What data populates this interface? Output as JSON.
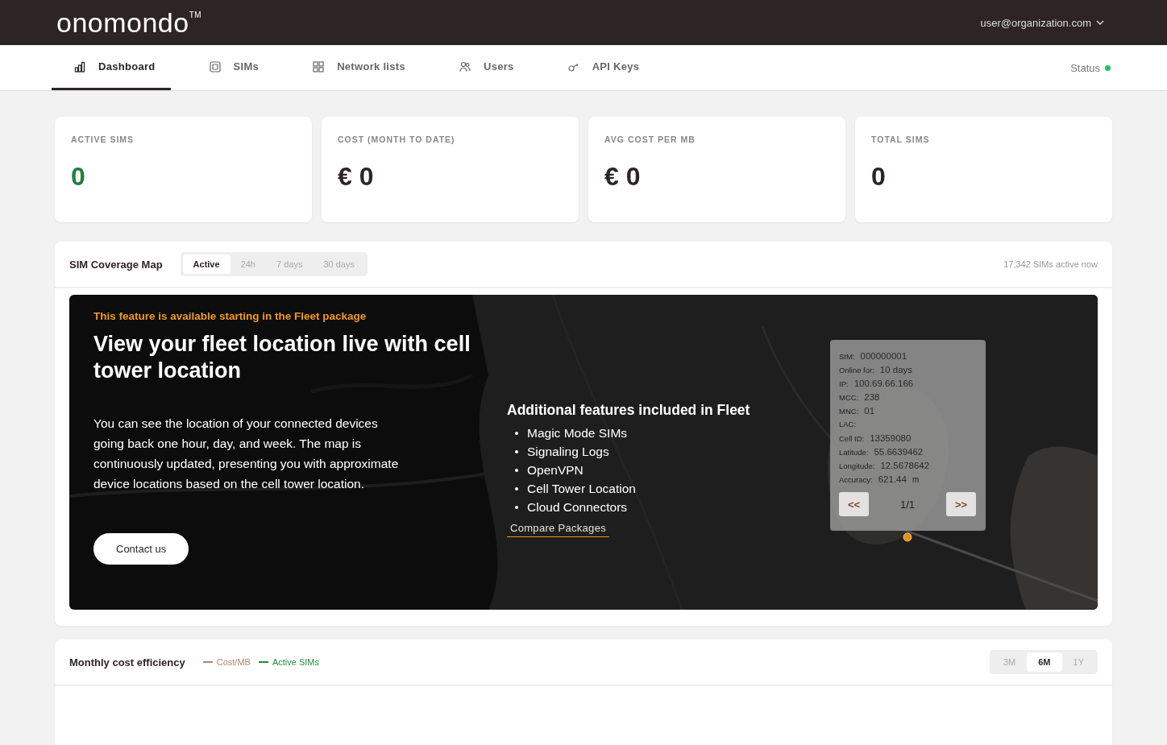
{
  "header": {
    "logo": "onomondo$^{TM}$",
    "account": "user@organization.com"
  },
  "nav": {
    "tabs": [
      {
        "label": "Dashboard",
        "selected": true
      },
      {
        "label": "SIMs",
        "selected": false
      },
      {
        "label": "Network lists",
        "selected": false
      },
      {
        "label": "Users",
        "selected": false
      },
      {
        "label": "API Keys",
        "selected": false
      }
    ],
    "status": {
      "label": "Status",
      "color": "#22c55e"
    }
  },
  "stats": [
    {
      "label": "ACTIVE SIMS",
      "value": "0",
      "color": "#1e7e3e"
    },
    {
      "label": "COST (MONTH TO DATE)",
      "value": "€ 0",
      "color": "#2d2523"
    },
    {
      "label": "AVG COST PER MB",
      "value": "€ 0",
      "color": "#2d2523"
    },
    {
      "label": "TOTAL SIMS",
      "value": "0",
      "color": "#2d2523"
    }
  ],
  "coverage": {
    "title": "SIM Coverage Map",
    "ranges": [
      {
        "label": "Active",
        "selected": true
      },
      {
        "label": "24h",
        "selected": false
      },
      {
        "label": "7 days",
        "selected": false
      },
      {
        "label": "30 days",
        "selected": false
      }
    ],
    "active_now": "17,342 SIMs active now",
    "upsell": {
      "notice": "This feature is available starting in the Fleet package",
      "heading": "View your fleet location live with cell tower location",
      "body": "You can see the location of your connected devices going back one hour, day, and week. The map is continuously updated, presenting you with approximate device locations based on the cell tower location.",
      "button": "Contact us",
      "features_title": "Additional features included in Fleet",
      "features": [
        "Magic Mode SIMs",
        "Signaling Logs",
        "OpenVPN",
        "Cell Tower Location",
        "Cloud Connectors"
      ],
      "compare_link": "Compare Packages"
    },
    "popup": {
      "fields": [
        {
          "label": "SIM:",
          "value": "000000001"
        },
        {
          "label": "Online for:",
          "value": "10 days"
        },
        {
          "label": "IP:",
          "value": "100.69.66.166"
        },
        {
          "label": "MCC:",
          "value": "238"
        },
        {
          "label": "MNC:",
          "value": "01"
        },
        {
          "label": "LAC:"
        },
        {
          "label": "Cell ID:",
          "value": "13359080"
        },
        {
          "label": "Latitude:",
          "value": "55.6639462"
        },
        {
          "label": "Longitude:",
          "value": "12.5678642"
        },
        {
          "label": "Accuracy:",
          "value": "621.44",
          "unit": "m"
        }
      ],
      "prev": "<<",
      "page": "1/1",
      "next": ">>"
    }
  },
  "efficiency": {
    "title": "Monthly cost efficiency",
    "legend": [
      {
        "label": "Cost/MB",
        "color": "#b08670"
      },
      {
        "label": "Active SIMs",
        "color": "#1e8e3e"
      }
    ],
    "ranges": [
      {
        "label": "3M",
        "selected": false
      },
      {
        "label": "6M",
        "selected": true
      },
      {
        "label": "1Y",
        "selected": false
      }
    ]
  }
}
